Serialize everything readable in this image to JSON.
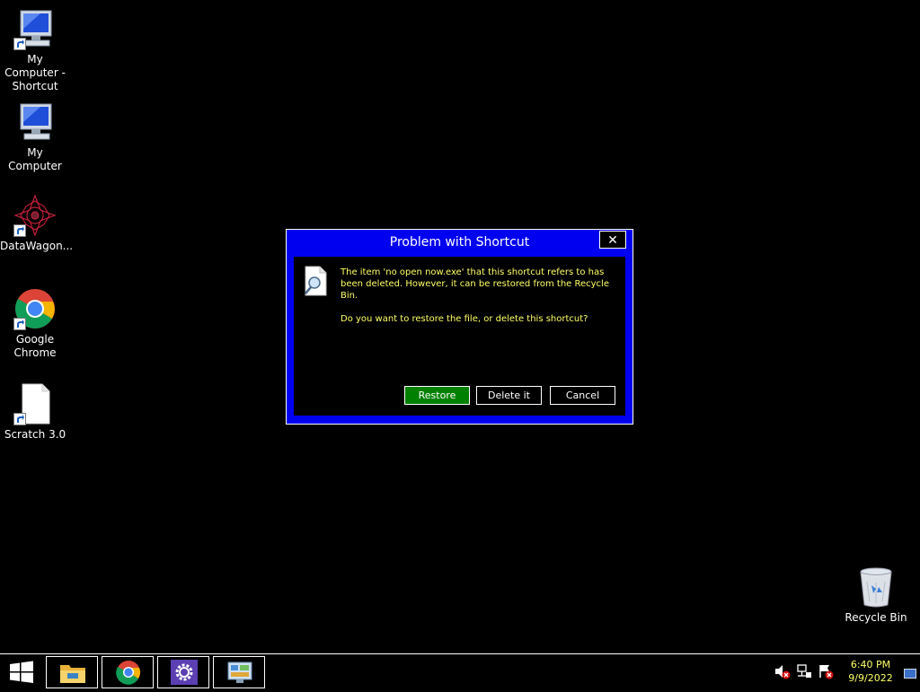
{
  "desktop": {
    "icons": [
      {
        "label": "My Computer - Shortcut",
        "icon": "computer-icon",
        "shortcut": true
      },
      {
        "label": "My Computer",
        "icon": "computer-icon",
        "shortcut": false
      },
      {
        "label": "DataWagon...",
        "icon": "datawagon-icon",
        "shortcut": true
      },
      {
        "label": "Google Chrome",
        "icon": "chrome-icon",
        "shortcut": true
      },
      {
        "label": "Scratch 3.0",
        "icon": "file-icon",
        "shortcut": true
      },
      {
        "label": "Recycle Bin",
        "icon": "recycle-bin-icon",
        "shortcut": false
      }
    ]
  },
  "dialog": {
    "title": "Problem with Shortcut",
    "close_label": "✕",
    "message1": "The item 'no open now.exe' that this shortcut refers to has been deleted. However, it can be restored from the Recycle Bin.",
    "message2": "Do you want to restore the file, or delete this shortcut?",
    "buttons": {
      "restore": "Restore",
      "delete": "Delete it",
      "cancel": "Cancel"
    }
  },
  "taskbar": {
    "pinned": [
      "file-explorer-icon",
      "chrome-icon",
      "settings-icon",
      "control-panel-icon"
    ],
    "tray": [
      "volume-muted-icon",
      "network-icon",
      "action-center-icon"
    ],
    "clock": {
      "time": "6:40 PM",
      "date": "9/9/2022"
    }
  },
  "colors": {
    "dialog_frame": "#0000f0",
    "message_text": "#ffff66",
    "primary_button": "#008000",
    "background": "#000000"
  }
}
